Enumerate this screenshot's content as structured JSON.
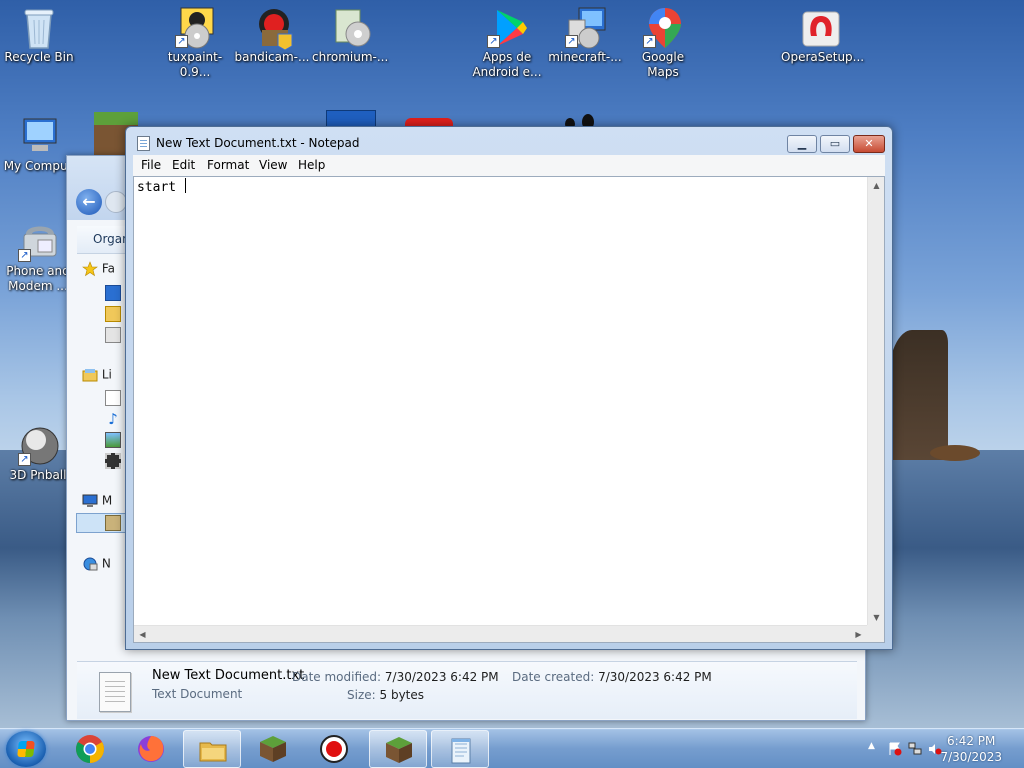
{
  "desktop": {
    "icons": [
      {
        "label": "Recycle Bin"
      },
      {
        "label": "tuxpaint-0.9..."
      },
      {
        "label": "bandicam-..."
      },
      {
        "label": "chromium-..."
      },
      {
        "label": "Apps de Android e..."
      },
      {
        "label": "minecraft-..."
      },
      {
        "label": "Google Maps"
      },
      {
        "label": "OperaSetup..."
      },
      {
        "label": "My Comput"
      },
      {
        "label": "Phone and Modem ..."
      },
      {
        "label": "3D Pnball"
      }
    ]
  },
  "explorer": {
    "command_label": "Organ",
    "nav": {
      "favorites": "Fa",
      "libraries": "Li",
      "computer": "M",
      "network": "N"
    },
    "details": {
      "file_name": "New Text Document.txt",
      "file_type": "Text Document",
      "date_modified_label": "Date modified:",
      "date_modified": "7/30/2023 6:42 PM",
      "date_created_label": "Date created:",
      "date_created": "7/30/2023 6:42 PM",
      "size_label": "Size:",
      "size": "5 bytes"
    }
  },
  "notepad": {
    "title": "New Text Document.txt - Notepad",
    "menu": [
      "File",
      "Edit",
      "Format",
      "View",
      "Help"
    ],
    "content": "start ",
    "buttons": {
      "minimize": "▁",
      "maximize": "▭",
      "close": "✕"
    }
  },
  "taskbar": {
    "time": "6:42 PM",
    "date": "7/30/2023",
    "tray_expand": "▲"
  }
}
